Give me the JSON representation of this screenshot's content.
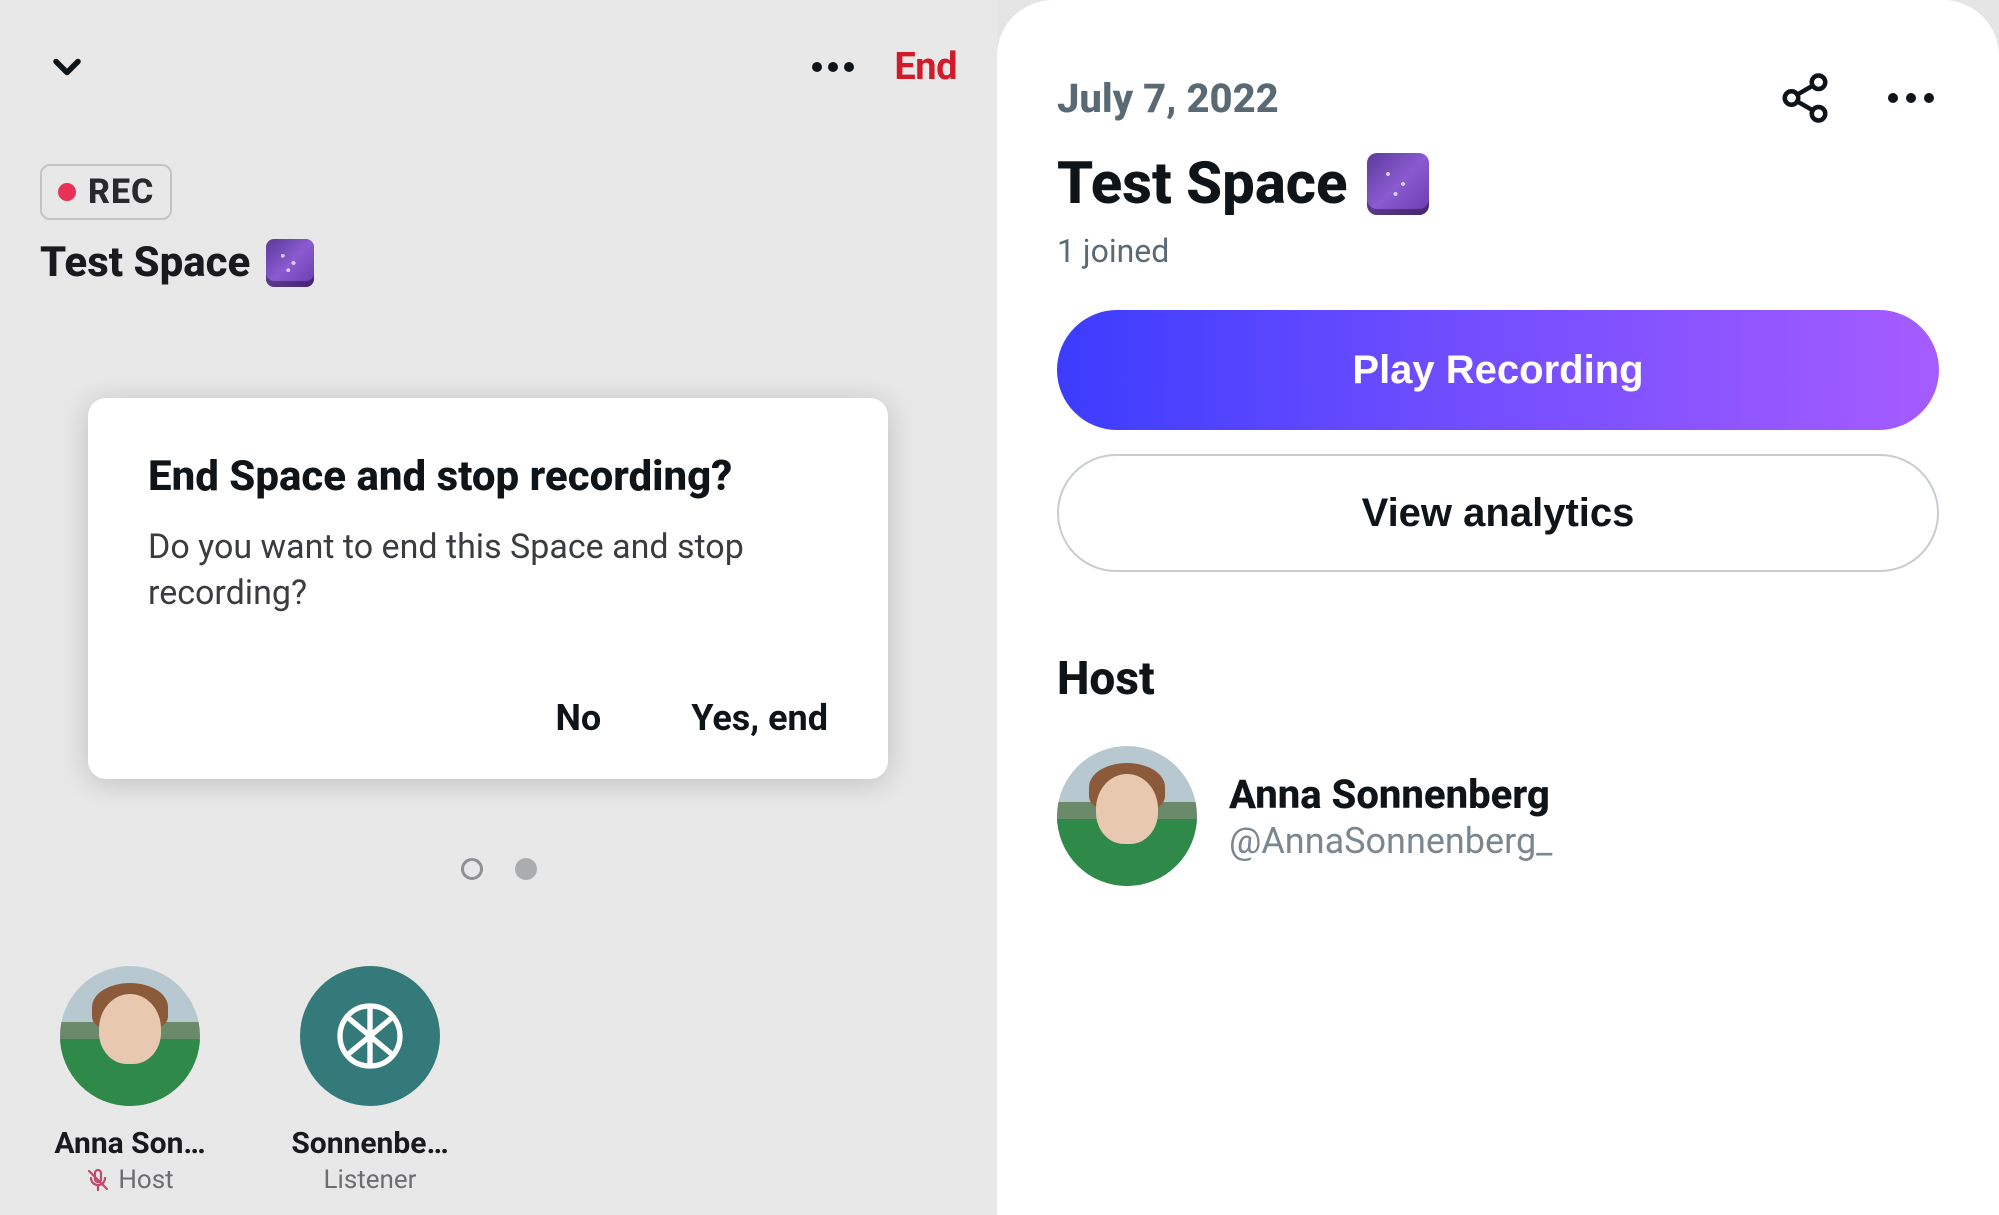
{
  "left": {
    "end_label": "End",
    "rec_label": "REC",
    "space_title": "Test Space",
    "pagination": {
      "active_index": 1,
      "count": 2
    },
    "participants": [
      {
        "name": "Anna Son…",
        "role": "Host",
        "muted": true,
        "avatar": "anna"
      },
      {
        "name": "Sonnenbe…",
        "role": "Listener",
        "muted": false,
        "avatar": "teal-leaf"
      }
    ]
  },
  "modal": {
    "title": "End Space and stop recording?",
    "body": "Do you want to end this Space and stop recording?",
    "no_label": "No",
    "yes_label": "Yes, end"
  },
  "right": {
    "date": "July 7, 2022",
    "space_title": "Test Space",
    "joined_text": "1 joined",
    "play_label": "Play Recording",
    "analytics_label": "View analytics",
    "host_section_title": "Host",
    "host": {
      "name": "Anna Sonnenberg",
      "handle": "@AnnaSonnenberg_"
    }
  }
}
